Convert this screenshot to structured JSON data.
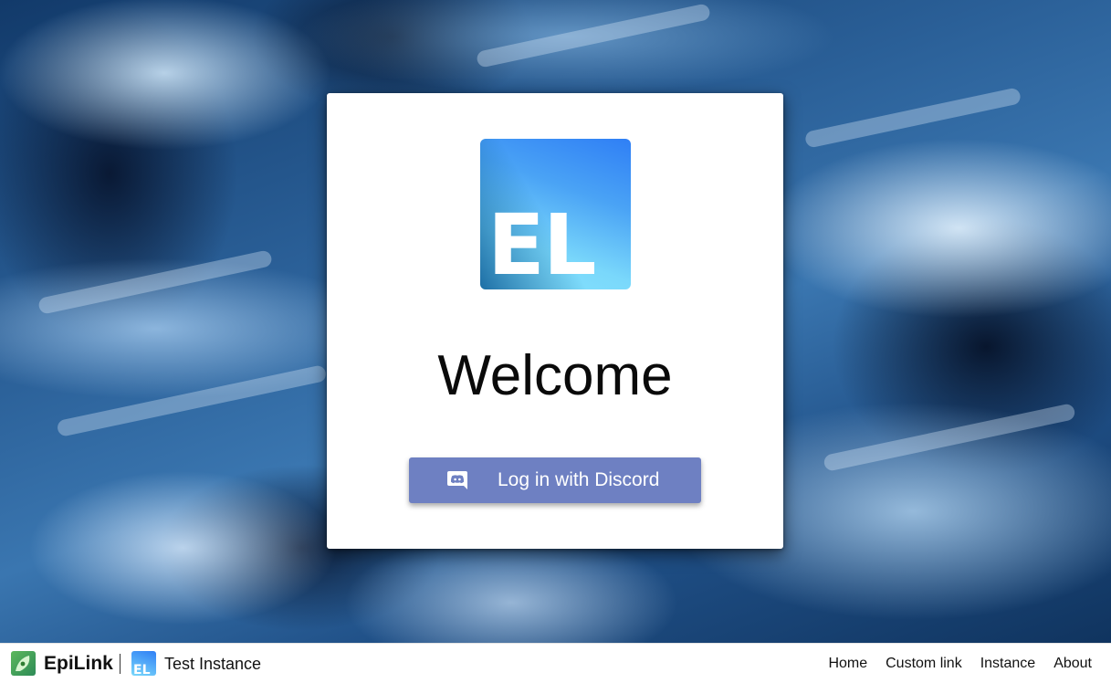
{
  "card": {
    "logo_text": "EL",
    "welcome_title": "Welcome",
    "login_button_label": "Log in with Discord",
    "login_button_icon": "discord-icon"
  },
  "footer": {
    "brand_name": "EpiLink",
    "instance_logo_text": "EL",
    "instance_name": "Test Instance",
    "nav": [
      {
        "label": "Home"
      },
      {
        "label": "Custom link"
      },
      {
        "label": "Instance"
      },
      {
        "label": "About"
      }
    ]
  },
  "colors": {
    "discord_button": "#6e80c2",
    "card_background": "#ffffff",
    "footer_background": "#ffffff"
  }
}
